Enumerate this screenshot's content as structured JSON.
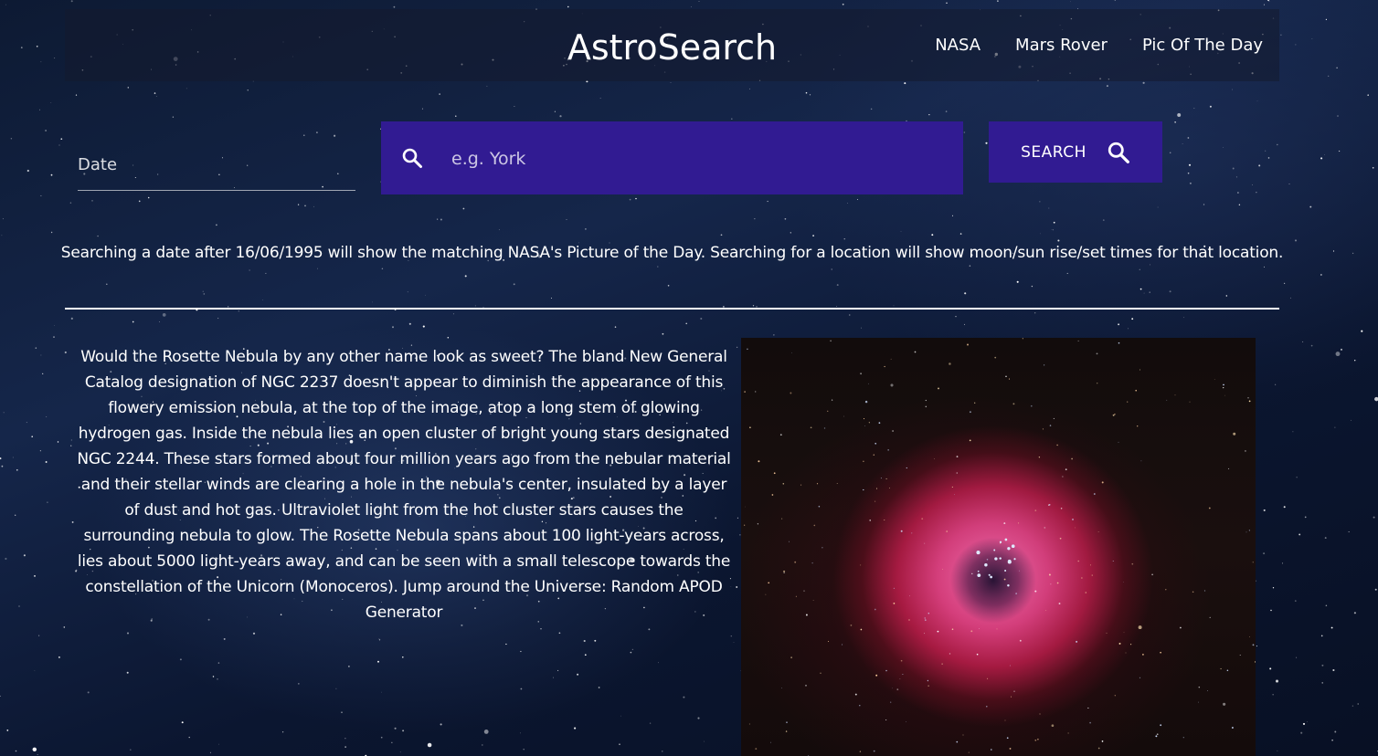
{
  "header": {
    "title": "AstroSearch",
    "nav": [
      "NASA",
      "Mars Rover",
      "Pic Of The Day"
    ]
  },
  "search": {
    "date_label": "Date",
    "placeholder": "e.g. York",
    "value": "",
    "button_label": "SEARCH",
    "icon": "search-icon"
  },
  "info_text": "Searching a date after 16/06/1995 will show the matching NASA's Picture of the Day. Searching for a location will show moon/sun rise/set times for that location.",
  "apod": {
    "explanation": "Would the Rosette Nebula by any other name look as sweet? The bland New General Catalog designation of NGC 2237 doesn't appear to diminish the appearance of this flowery emission nebula, at the top of the image, atop a long stem of glowing hydrogen gas. Inside the nebula lies an open cluster of bright young stars designated NGC 2244. These stars formed about four million years ago from the nebular material and their stellar winds are clearing a hole in the nebula's center, insulated by a layer of dust and hot gas. Ultraviolet light from the hot cluster stars causes the surrounding nebula to glow. The Rosette Nebula spans about 100 light-years across, lies about 5000 light-years away, and can be seen with a small telescope towards the constellation of the Unicorn (Monoceros). Jump around the Universe: Random APOD Generator"
  },
  "colors": {
    "accent": "#311b92",
    "text": "#ffffff",
    "background": "#0d1a33"
  }
}
